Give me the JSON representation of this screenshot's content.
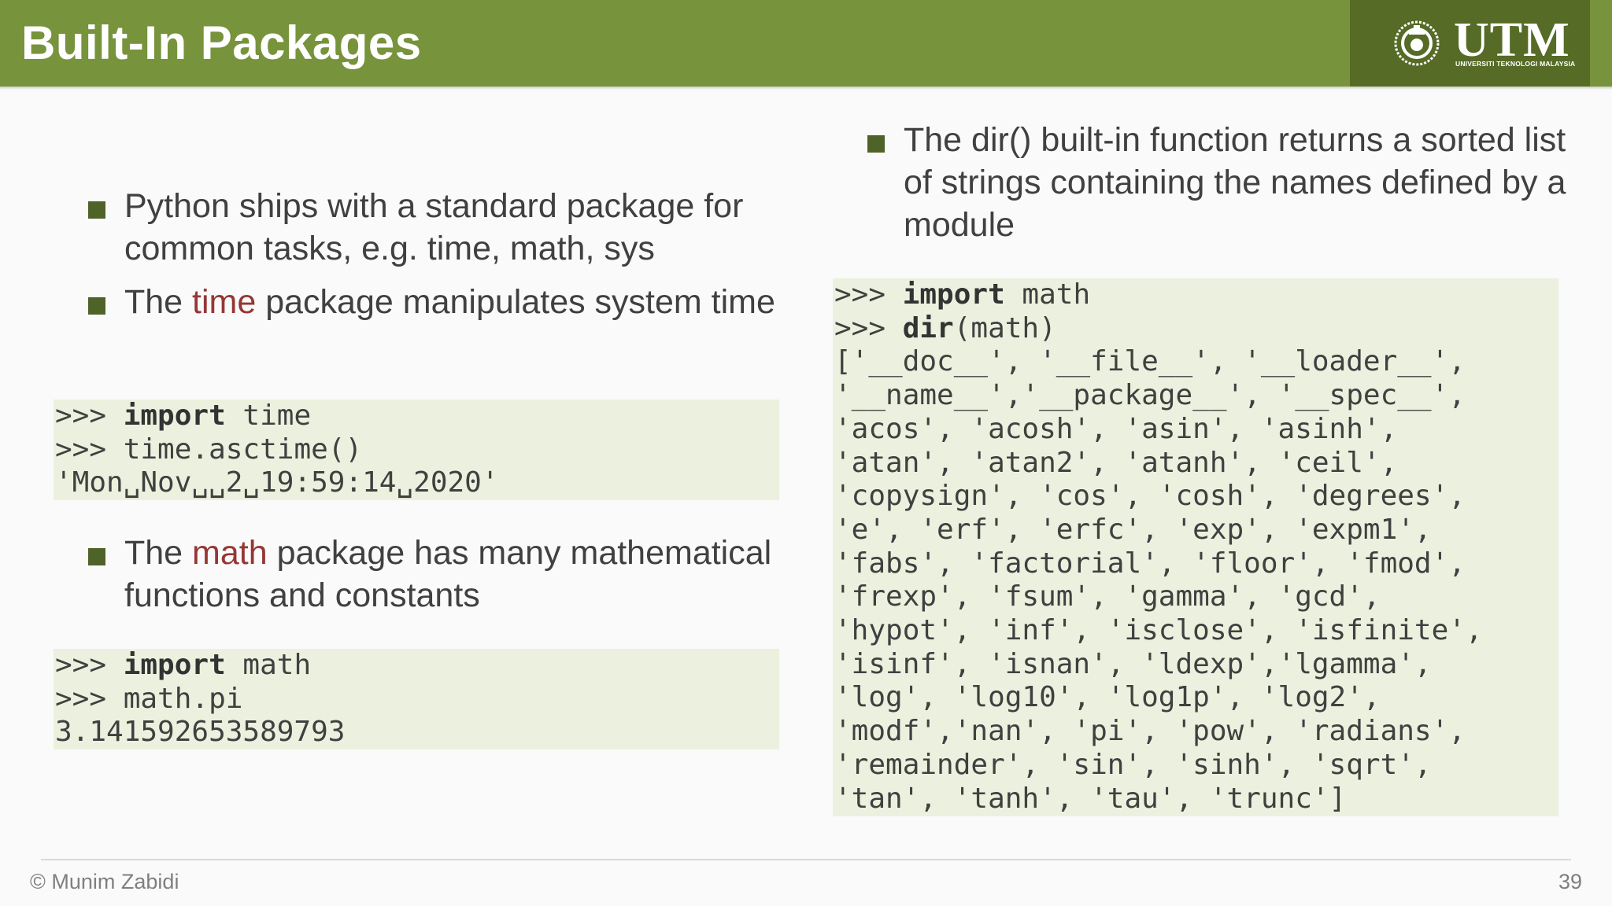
{
  "slide": {
    "title": "Built-In Packages"
  },
  "logo": {
    "text": "UTM",
    "subtitle": "UNIVERSITI TEKNOLOGI MALAYSIA",
    "icon": "utm-seal-icon"
  },
  "colors": {
    "header": "#77933c",
    "logo_background": "#566b26",
    "bullet": "#4f6228",
    "highlight": "#953735",
    "code_background": "#ebf1de"
  },
  "left": {
    "bullets_top": [
      {
        "text": "Python ships with a standard package for common tasks, e.g. time, math, sys"
      },
      {
        "pre": "The ",
        "highlight": "time",
        "post": " package manipulates system time"
      }
    ],
    "code_time": {
      "prompt1": ">>> ",
      "kw1": "import",
      "rest1": " time",
      "prompt2": ">>> ",
      "rest2": "time.asctime()",
      "output": "'Mon␣Nov␣␣2␣19:59:14␣2020'"
    },
    "bullet_math": {
      "pre": "The ",
      "highlight": "math",
      "post": " package has many mathematical functions and constants"
    },
    "code_math": {
      "prompt1": ">>> ",
      "kw1": "import",
      "rest1": " math",
      "prompt2": ">>> ",
      "rest2": "math.pi",
      "output": "3.141592653589793"
    }
  },
  "right": {
    "bullet": {
      "text": "The dir() built-in function returns a sorted list of strings containing the names defined by a module"
    },
    "code_dir": {
      "prompt1": ">>> ",
      "kw1": "import",
      "rest1": " math",
      "prompt2": ">>> ",
      "kw2": "dir",
      "rest2": "(math)",
      "output": "['__doc__', '__file__', '__loader__',\n'__name__','__package__', '__spec__',\n'acos', 'acosh', 'asin', 'asinh',\n'atan', 'atan2', 'atanh', 'ceil',\n'copysign', 'cos', 'cosh', 'degrees',\n'e', 'erf', 'erfc', 'exp', 'expm1',\n'fabs', 'factorial', 'floor', 'fmod',\n'frexp', 'fsum', 'gamma', 'gcd',\n'hypot', 'inf', 'isclose', 'isfinite',\n'isinf', 'isnan', 'ldexp','lgamma',\n'log', 'log10', 'log1p', 'log2',\n'modf','nan', 'pi', 'pow', 'radians',\n'remainder', 'sin', 'sinh', 'sqrt',\n'tan', 'tanh', 'tau', 'trunc']"
    }
  },
  "footer": {
    "copyright": "© Munim Zabidi",
    "page_number": "39"
  }
}
